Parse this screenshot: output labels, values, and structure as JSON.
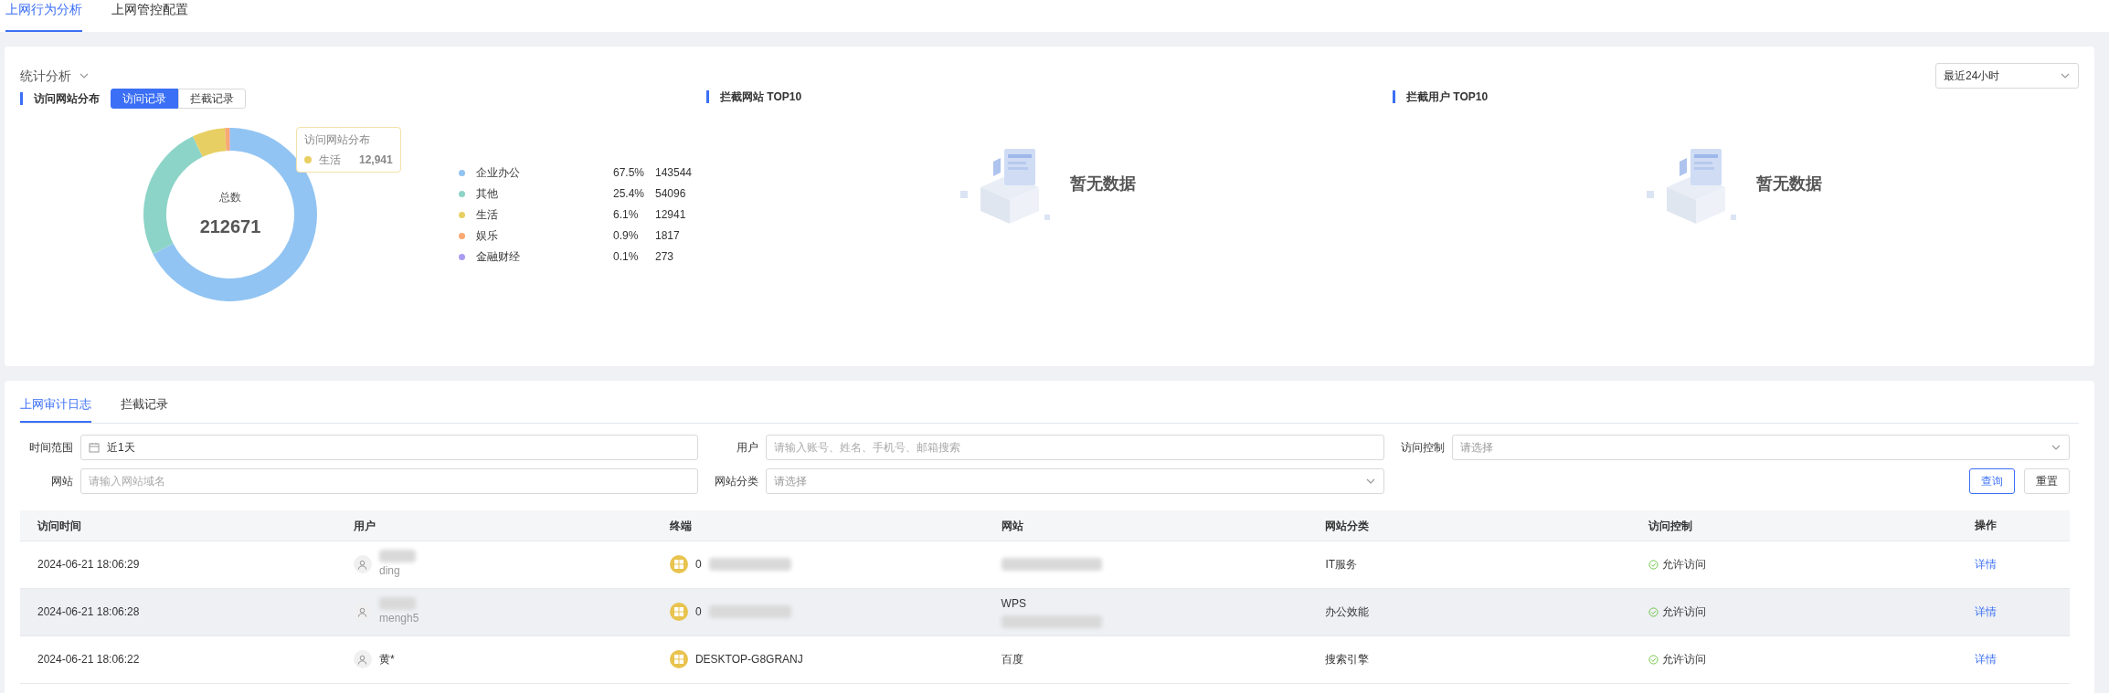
{
  "tabs": [
    {
      "label": "上网行为分析",
      "selected": true
    },
    {
      "label": "上网管控配置",
      "selected": false
    }
  ],
  "stats": {
    "title": "统计分析",
    "range": "最近24小时",
    "distribution": {
      "title": "访问网站分布",
      "toggles": [
        {
          "label": "访问记录",
          "selected": true
        },
        {
          "label": "拦截记录",
          "selected": false
        }
      ],
      "total_label": "总数",
      "total": "212671",
      "tooltip": {
        "name": "生活",
        "value": "12,941",
        "color": "#e8cf63"
      },
      "chart_data": {
        "type": "donut",
        "categories": [
          "企业办公",
          "其他",
          "生活",
          "娱乐",
          "金融财经"
        ],
        "series": [
          {
            "name": "访问网站分布",
            "values": [
              67.5,
              25.4,
              6.1,
              0.9,
              0.1
            ]
          }
        ]
      },
      "legend": [
        {
          "percent": "67.5%",
          "count": "143544",
          "color": "#91c4f2"
        },
        {
          "percent": "25.4%",
          "count": "54096",
          "color": "#8dd4c8"
        },
        {
          "percent": "6.1%",
          "count": "12941",
          "color": "#e8cf63"
        },
        {
          "percent": "0.9%",
          "count": "1817",
          "color": "#f8a872"
        },
        {
          "percent": "0.1%",
          "count": "273",
          "color": "#a99cf0"
        }
      ]
    },
    "panels": [
      {
        "title": "拦截网站 TOP10",
        "empty": "暂无数据"
      },
      {
        "title": "拦截用户 TOP10",
        "empty": "暂无数据"
      }
    ]
  },
  "log": {
    "tabs": [
      {
        "label": "上网审计日志",
        "selected": true
      },
      {
        "label": "拦截记录",
        "selected": false
      }
    ],
    "filters": [
      {
        "label": "时间范围",
        "kind": "date",
        "value": "近1天"
      },
      {
        "label": "用户",
        "kind": "text",
        "placeholder": "请输入账号、姓名、手机号、邮箱搜索"
      },
      {
        "label": "访问控制",
        "kind": "select",
        "placeholder": "请选择"
      },
      {
        "label": "网站",
        "kind": "text",
        "placeholder": "请输入网站域名"
      },
      {
        "label": "网站分类",
        "kind": "select",
        "placeholder": "请选择"
      }
    ],
    "buttons": [
      {
        "label": "查询",
        "kind": "primary"
      },
      {
        "label": "重置",
        "kind": "default"
      }
    ],
    "columns": [
      "访问时间",
      "用户",
      "终端",
      "网站",
      "网站分类",
      "访问控制",
      "操作"
    ],
    "rows": [
      {
        "time": "2024-06-21 18:06:29",
        "user": {
          "account": "ding"
        },
        "terminal": "0",
        "category": "IT服务",
        "control": "允许访问",
        "action": "详情",
        "selected": false
      },
      {
        "time": "2024-06-21 18:06:28",
        "user": {
          "account": "mengh5"
        },
        "terminal": "0",
        "site": "WPS",
        "category": "办公效能",
        "control": "允许访问",
        "action": "详情",
        "selected": true
      },
      {
        "time": "2024-06-21 18:06:22",
        "user": {
          "name": "黄*"
        },
        "terminal": "DESKTOP-G8GRANJ",
        "site": "百度",
        "category": "搜索引擎",
        "control": "允许访问",
        "action": "详情",
        "selected": false
      }
    ]
  }
}
